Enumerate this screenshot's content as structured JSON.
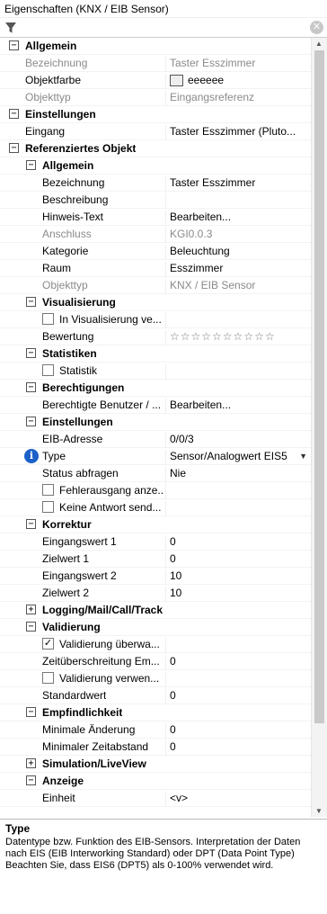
{
  "title": "Eigenschaften (KNX / EIB Sensor)",
  "pin_icon": "pin-icon",
  "filter": {
    "value": "",
    "placeholder": ""
  },
  "rows": [
    {
      "t": "cat",
      "d": 0,
      "exp": "−",
      "label": "Allgemein"
    },
    {
      "t": "prop",
      "d": 0,
      "label": "Bezeichnung",
      "value": "Taster Esszimmer",
      "disabled": true
    },
    {
      "t": "prop",
      "d": 0,
      "label": "Objektfarbe",
      "value": "eeeeee",
      "swatch": "#eeeeee"
    },
    {
      "t": "prop",
      "d": 0,
      "label": "Objekttyp",
      "value": "Eingangsreferenz",
      "disabled": true
    },
    {
      "t": "cat",
      "d": 0,
      "exp": "−",
      "label": "Einstellungen"
    },
    {
      "t": "prop",
      "d": 0,
      "label": "Eingang",
      "value": "Taster Esszimmer (Pluto..."
    },
    {
      "t": "cat",
      "d": 0,
      "exp": "−",
      "label": "Referenziertes Objekt"
    },
    {
      "t": "cat",
      "d": 1,
      "exp": "−",
      "label": "Allgemein"
    },
    {
      "t": "prop",
      "d": 1,
      "label": "Bezeichnung",
      "value": "Taster Esszimmer"
    },
    {
      "t": "prop",
      "d": 1,
      "label": "Beschreibung",
      "value": ""
    },
    {
      "t": "prop",
      "d": 1,
      "label": "Hinweis-Text",
      "value": "Bearbeiten..."
    },
    {
      "t": "prop",
      "d": 1,
      "label": "Anschluss",
      "value": "KGI0.0.3",
      "disabled": true
    },
    {
      "t": "prop",
      "d": 1,
      "label": "Kategorie",
      "value": "Beleuchtung"
    },
    {
      "t": "prop",
      "d": 1,
      "label": "Raum",
      "value": "Esszimmer"
    },
    {
      "t": "prop",
      "d": 1,
      "label": "Objekttyp",
      "value": "KNX / EIB Sensor",
      "disabled": true
    },
    {
      "t": "cat",
      "d": 1,
      "exp": "−",
      "label": "Visualisierung"
    },
    {
      "t": "prop",
      "d": 1,
      "cb": true,
      "checked": false,
      "label": "In Visualisierung ve...",
      "value": ""
    },
    {
      "t": "prop",
      "d": 1,
      "label": "Bewertung",
      "value": "☆☆☆☆☆☆☆☆☆☆",
      "stars": true
    },
    {
      "t": "cat",
      "d": 1,
      "exp": "−",
      "label": "Statistiken"
    },
    {
      "t": "prop",
      "d": 1,
      "cb": true,
      "checked": false,
      "label": "Statistik",
      "value": ""
    },
    {
      "t": "cat",
      "d": 1,
      "exp": "−",
      "label": "Berechtigungen"
    },
    {
      "t": "prop",
      "d": 1,
      "label": "Berechtigte Benutzer / ...",
      "value": "Bearbeiten..."
    },
    {
      "t": "cat",
      "d": 1,
      "exp": "−",
      "label": "Einstellungen"
    },
    {
      "t": "prop",
      "d": 1,
      "label": "EIB-Adresse",
      "value": "0/0/3"
    },
    {
      "t": "prop",
      "d": 1,
      "info": true,
      "label": "Type",
      "value": "Sensor/Analogwert EIS5",
      "dropdown": true
    },
    {
      "t": "prop",
      "d": 1,
      "label": "Status abfragen",
      "value": "Nie"
    },
    {
      "t": "prop",
      "d": 1,
      "cb": true,
      "checked": false,
      "label": "Fehlerausgang anze...",
      "value": ""
    },
    {
      "t": "prop",
      "d": 1,
      "cb": true,
      "checked": false,
      "label": "Keine Antwort send...",
      "value": ""
    },
    {
      "t": "cat",
      "d": 1,
      "exp": "−",
      "label": "Korrektur"
    },
    {
      "t": "prop",
      "d": 1,
      "label": "Eingangswert 1",
      "value": "0"
    },
    {
      "t": "prop",
      "d": 1,
      "label": "Zielwert 1",
      "value": "0"
    },
    {
      "t": "prop",
      "d": 1,
      "label": "Eingangswert 2",
      "value": "10"
    },
    {
      "t": "prop",
      "d": 1,
      "label": "Zielwert 2",
      "value": "10"
    },
    {
      "t": "cat",
      "d": 1,
      "exp": "+",
      "label": "Logging/Mail/Call/Track"
    },
    {
      "t": "cat",
      "d": 1,
      "exp": "−",
      "label": "Validierung"
    },
    {
      "t": "prop",
      "d": 1,
      "cb": true,
      "checked": true,
      "label": "Validierung überwa...",
      "value": ""
    },
    {
      "t": "prop",
      "d": 1,
      "label": "Zeitüberschreitung Em...",
      "value": "0"
    },
    {
      "t": "prop",
      "d": 1,
      "cb": true,
      "checked": false,
      "label": "Validierung verwen...",
      "value": ""
    },
    {
      "t": "prop",
      "d": 1,
      "label": "Standardwert",
      "value": "0"
    },
    {
      "t": "cat",
      "d": 1,
      "exp": "−",
      "label": "Empfindlichkeit"
    },
    {
      "t": "prop",
      "d": 1,
      "label": "Minimale Änderung",
      "value": "0"
    },
    {
      "t": "prop",
      "d": 1,
      "label": "Minimaler Zeitabstand",
      "value": "0"
    },
    {
      "t": "cat",
      "d": 1,
      "exp": "+",
      "label": "Simulation/LiveView"
    },
    {
      "t": "cat",
      "d": 1,
      "exp": "−",
      "label": "Anzeige"
    },
    {
      "t": "prop",
      "d": 1,
      "label": "Einheit",
      "value": "<v>"
    }
  ],
  "description": {
    "title": "Type",
    "text": "Datentype bzw. Funktion des EIB-Sensors. Interpretation der Daten nach EIS (EIB Interworking Standard) oder DPT (Data Point Type) Beachten Sie, dass EIS6 (DPT5) als 0-100% verwendet wird."
  }
}
